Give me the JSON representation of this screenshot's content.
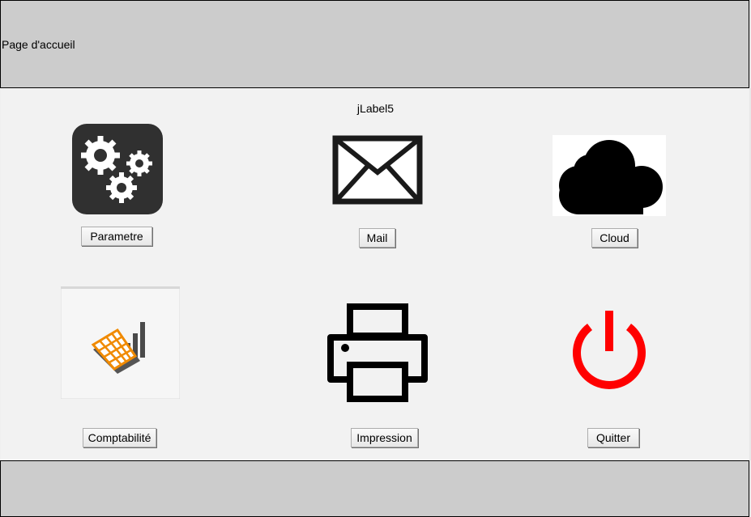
{
  "header": {
    "title": "Page d'accueil"
  },
  "main": {
    "label": "jLabel5",
    "buttons": {
      "parametre": "Parametre",
      "mail": "Mail",
      "cloud": "Cloud",
      "comptabilite": "Comptabilité",
      "impression": "Impression",
      "quitter": "Quitter"
    },
    "icons": {
      "parametre": "gears-icon",
      "mail": "envelope-icon",
      "cloud": "cloud-icon",
      "comptabilite": "accounting-chart-icon",
      "impression": "printer-icon",
      "quitter": "power-icon"
    }
  },
  "colors": {
    "header_bg": "#cccccc",
    "main_bg": "#f2f2f2",
    "power_red": "#ff0000",
    "accounting_orange": "#f08a00"
  }
}
